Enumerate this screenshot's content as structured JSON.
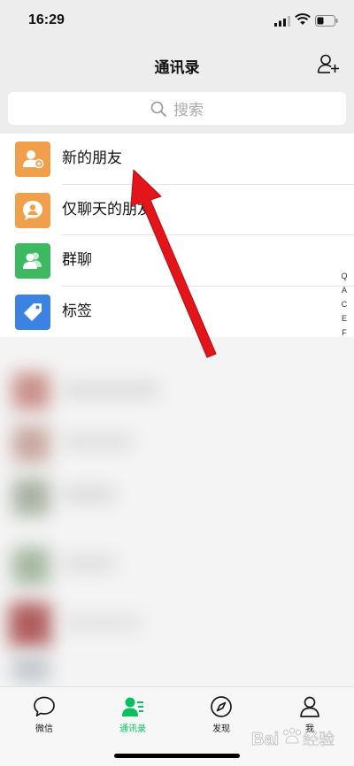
{
  "status_bar": {
    "time": "16:29"
  },
  "nav": {
    "title": "通讯录"
  },
  "search": {
    "placeholder": "搜索"
  },
  "contacts": {
    "items": [
      {
        "label": "新的朋友",
        "icon": "add-friend-icon",
        "color": "#f0a04b"
      },
      {
        "label": "仅聊天的朋友",
        "icon": "chat-only-friend-icon",
        "color": "#f0a04b"
      },
      {
        "label": "群聊",
        "icon": "group-chat-icon",
        "color": "#3fb961"
      },
      {
        "label": "标签",
        "icon": "tag-icon",
        "color": "#3b82e3"
      }
    ]
  },
  "index_bar": {
    "items": [
      "Q",
      "A",
      "C",
      "E",
      "F"
    ]
  },
  "tab_bar": {
    "tabs": [
      {
        "label": "微信",
        "icon": "chat-bubble-icon",
        "active": false
      },
      {
        "label": "通讯录",
        "icon": "contacts-icon",
        "active": true
      },
      {
        "label": "发现",
        "icon": "compass-icon",
        "active": false
      },
      {
        "label": "我",
        "icon": "person-icon",
        "active": false
      }
    ]
  },
  "watermark": {
    "text": "Bai经验"
  },
  "colors": {
    "accent": "#07c160",
    "arrow": "#e3141a",
    "background": "#ededed"
  }
}
